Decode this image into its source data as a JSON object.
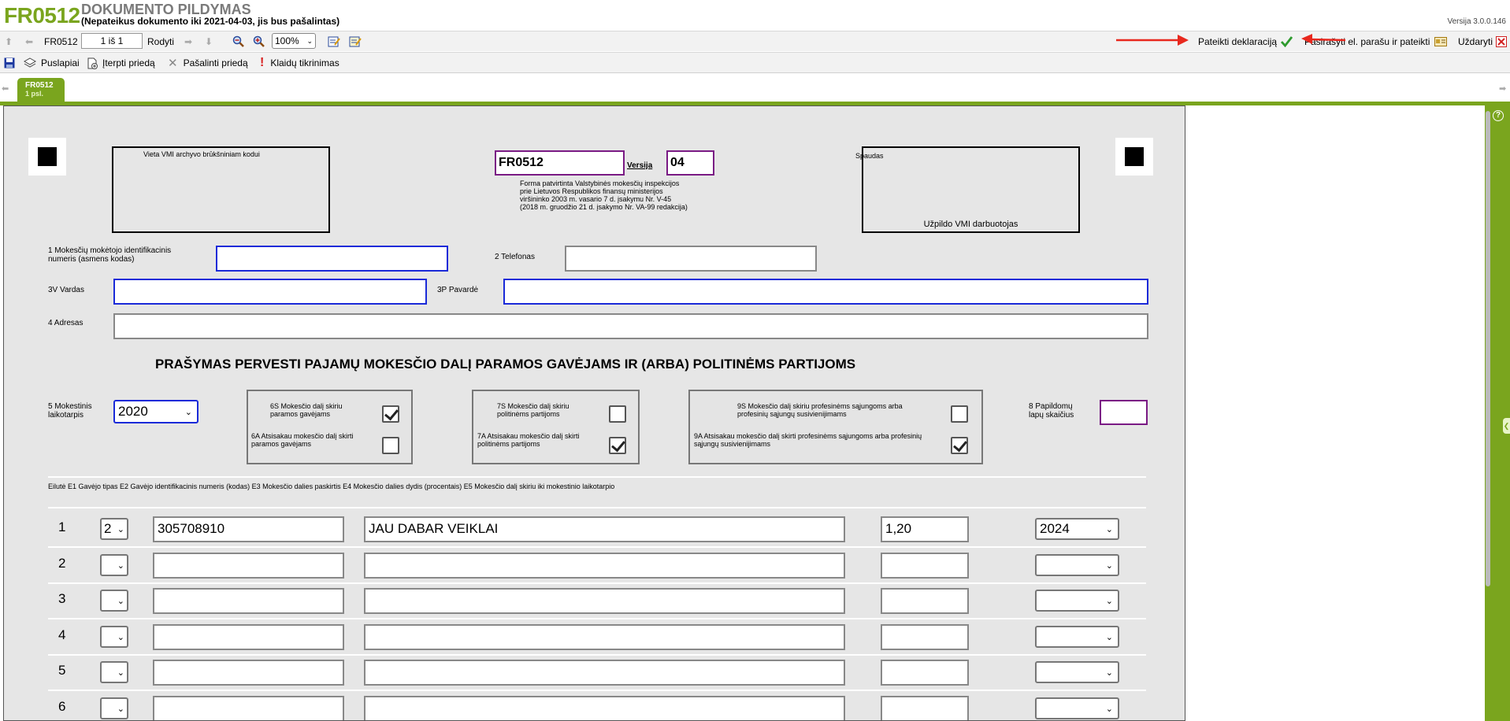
{
  "header": {
    "code": "FR0512",
    "title": "DOKUMENTO PILDYMAS",
    "subtitle": "(Nepateikus dokumento iki 2021-04-03, jis bus pašalintas)",
    "version": "Versija 3.0.0.146"
  },
  "toolbar1": {
    "doc_code": "FR0512",
    "page_value": "1 iš 1",
    "show_label": "Rodyti",
    "zoom": "100%",
    "submit_label": "Pateikti deklaraciją",
    "sign_label": "Pasirašyti el. parašu ir pateikti",
    "close_label": "Uždaryti"
  },
  "toolbar2": {
    "pages_label": "Puslapiai",
    "insert_label": "Įterpti priedą",
    "remove_label": "Pašalinti priedą",
    "check_label": "Klaidų tikrinimas"
  },
  "tab": {
    "label": "FR0512",
    "page": "1 psl."
  },
  "form": {
    "archive_box": "Vieta VMI archyvo brūkšniniam kodui",
    "form_code": "FR0512",
    "version_label": "Versija",
    "version_value": "04",
    "approval_text": [
      "Forma patvirtinta Valstybinės mokesčių inspekcijos",
      "prie Lietuvos Respublikos finansų ministerijos",
      "viršininko 2003 m. vasario 7 d. įsakymu Nr. V-45",
      "(2018 m. gruodžio 21 d. įsakymo Nr. VA-99 redakcija)"
    ],
    "stamp_label": "Spaudas",
    "stamp_footer": "Užpildo VMI darbuotojas",
    "f1_label": "1 Mokesčių mokėtojo identifikacinis numeris (asmens kodas)",
    "f2_label": "2 Telefonas",
    "f3v_label": "3V Vardas",
    "f3p_label": "3P Pavardė",
    "f4_label": "4 Adresas",
    "main_title": "PRAŠYMAS PERVESTI PAJAMŲ MOKESČIO DALĮ PARAMOS GAVĖJAMS IR (ARBA) POLITINĖMS PARTIJOMS",
    "f5_label": "5 Mokestinis laikotarpis",
    "f5_value": "2020",
    "f6s_label": "6S Mokesčio dalį skiriu paramos gavėjams",
    "f6s_checked": true,
    "f6a_label": "6A Atsisakau mokesčio dalį skirti paramos gavėjams",
    "f6a_checked": false,
    "f7s_label": "7S Mokesčio dalį skiriu politinėms partijoms",
    "f7s_checked": false,
    "f7a_label": "7A Atsisakau mokesčio dalį skirti politinėms partijoms",
    "f7a_checked": true,
    "f9s_label": "9S Mokesčio dalį skiriu profesinėms sąjungoms arba profesinių sąjungų susivienijimams",
    "f9s_checked": false,
    "f9a_label": "9A Atsisakau mokesčio dalį skirti profesinėms sąjungoms arba profesinių sąjungų susivienijimams",
    "f9a_checked": true,
    "f8_label": "8 Papildomų lapų skaičius",
    "table_header": "Eilutė E1 Gavėjo tipas E2 Gavėjo identifikacinis numeris (kodas) E3 Mokesčio dalies paskirtis E4 Mokesčio dalies dydis (procentais) E5 Mokesčio dalį skiriu iki mokestinio laikotarpio",
    "rows": [
      {
        "num": "1",
        "type": "2",
        "id": "305708910",
        "purpose": "JAU DABAR VEIKLAI",
        "percent": "1,20",
        "year": "2024"
      },
      {
        "num": "2",
        "type": "",
        "id": "",
        "purpose": "",
        "percent": "",
        "year": ""
      },
      {
        "num": "3",
        "type": "",
        "id": "",
        "purpose": "",
        "percent": "",
        "year": ""
      },
      {
        "num": "4",
        "type": "",
        "id": "",
        "purpose": "",
        "percent": "",
        "year": ""
      },
      {
        "num": "5",
        "type": "",
        "id": "",
        "purpose": "",
        "percent": "",
        "year": ""
      },
      {
        "num": "6",
        "type": "",
        "id": "",
        "purpose": "",
        "percent": "",
        "year": ""
      }
    ]
  },
  "colors": {
    "brand_green": "#7aa51e",
    "field_blue": "#1a2ad8",
    "field_purple": "#7a1a84",
    "arrow_red": "#e8281e"
  }
}
